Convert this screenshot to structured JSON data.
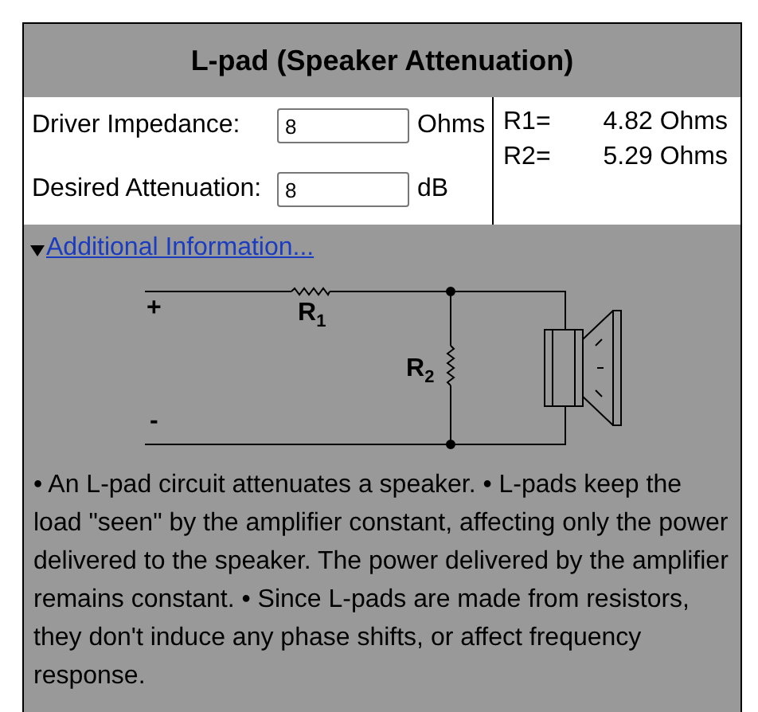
{
  "title": "L-pad (Speaker Attenuation)",
  "inputs": [
    {
      "label": "Driver Impedance:",
      "value": "8",
      "unit": "Ohms"
    },
    {
      "label": "Desired Attenuation:",
      "value": "8",
      "unit": "dB"
    }
  ],
  "results": [
    {
      "label": "R1=",
      "value": "4.82 Ohms"
    },
    {
      "label": "R2=",
      "value": "5.29 Ohms"
    }
  ],
  "details": {
    "expanded": true,
    "link": "Additional Information...",
    "circuit_labels": {
      "plus": "+",
      "minus": "-",
      "r1": "R$_{1}$",
      "r2": "R$_{2}$"
    },
    "text": "• An L-pad circuit attenuates a speaker. • L-pads keep the load \"seen\" by the amplifier constant, affecting only the power delivered to the speaker. The power delivered by the amplifier remains constant. • Since L-pads are made from resistors, they don't induce any phase shifts, or affect frequency response."
  }
}
